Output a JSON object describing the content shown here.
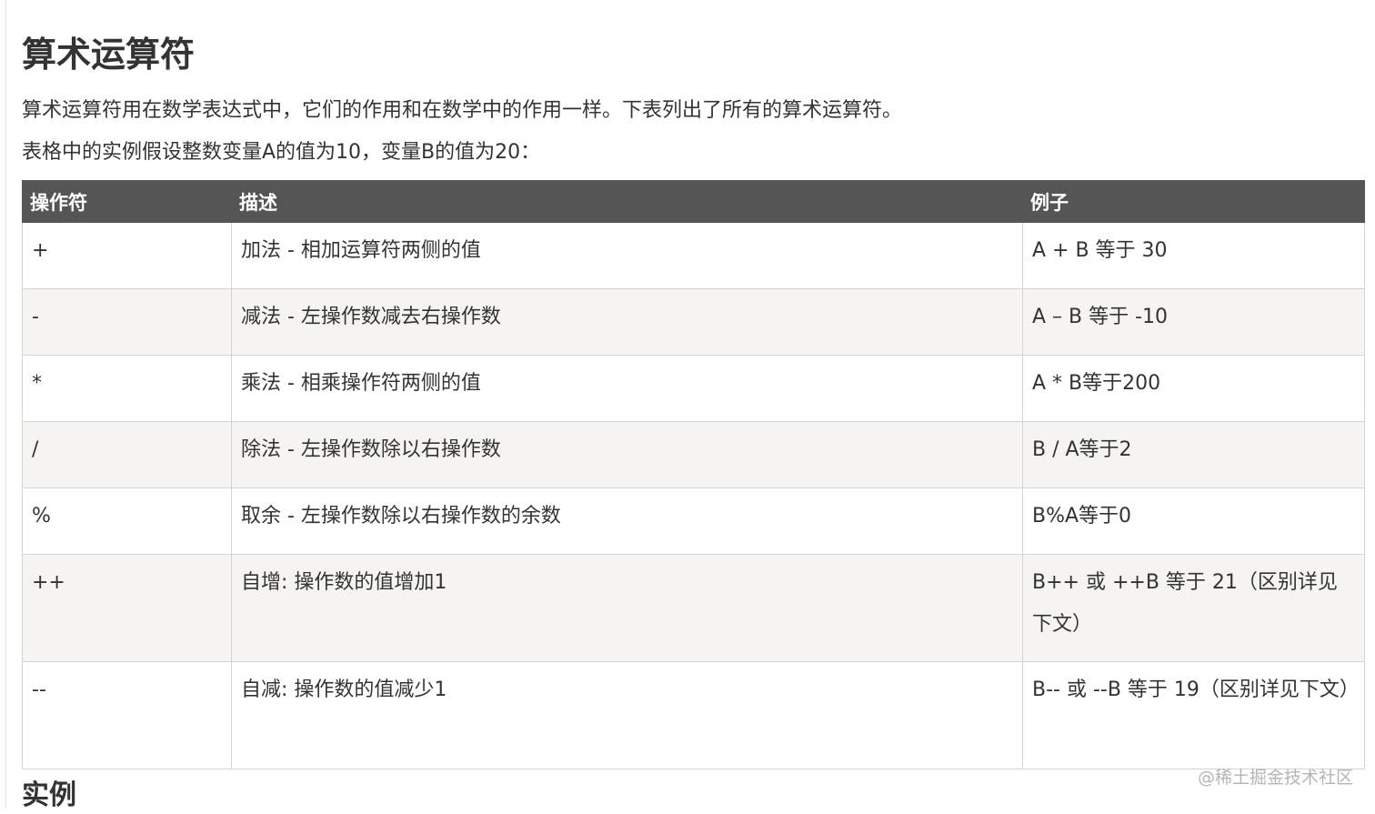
{
  "page": {
    "title": "算术运算符",
    "intro_1": "算术运算符用在数学表达式中，它们的作用和在数学中的作用一样。下表列出了所有的算术运算符。",
    "intro_2": "表格中的实例假设整数变量A的值为10，变量B的值为20："
  },
  "table": {
    "headers": [
      "操作符",
      "描述",
      "例子"
    ],
    "rows": [
      {
        "op": "+",
        "desc": "加法 - 相加运算符两侧的值",
        "example": "A + B 等于 30"
      },
      {
        "op": "-",
        "desc": "减法 - 左操作数减去右操作数",
        "example": "A – B 等于 -10"
      },
      {
        "op": "*",
        "desc": "乘法 - 相乘操作符两侧的值",
        "example": "A * B等于200"
      },
      {
        "op": "/",
        "desc": "除法 - 左操作数除以右操作数",
        "example": "B / A等于2"
      },
      {
        "op": "%",
        "desc": "取余 - 左操作数除以右操作数的余数",
        "example": "B%A等于0"
      },
      {
        "op": "++",
        "desc": "自增: 操作数的值增加1",
        "example": "B++ 或 ++B 等于 21（区别详见下文）"
      },
      {
        "op": "--",
        "desc": "自减: 操作数的值减少1",
        "example": "B-- 或 --B 等于 19（区别详见下文）"
      }
    ]
  },
  "section": {
    "title": "实例"
  },
  "watermark": "@稀土掘金技术社区"
}
